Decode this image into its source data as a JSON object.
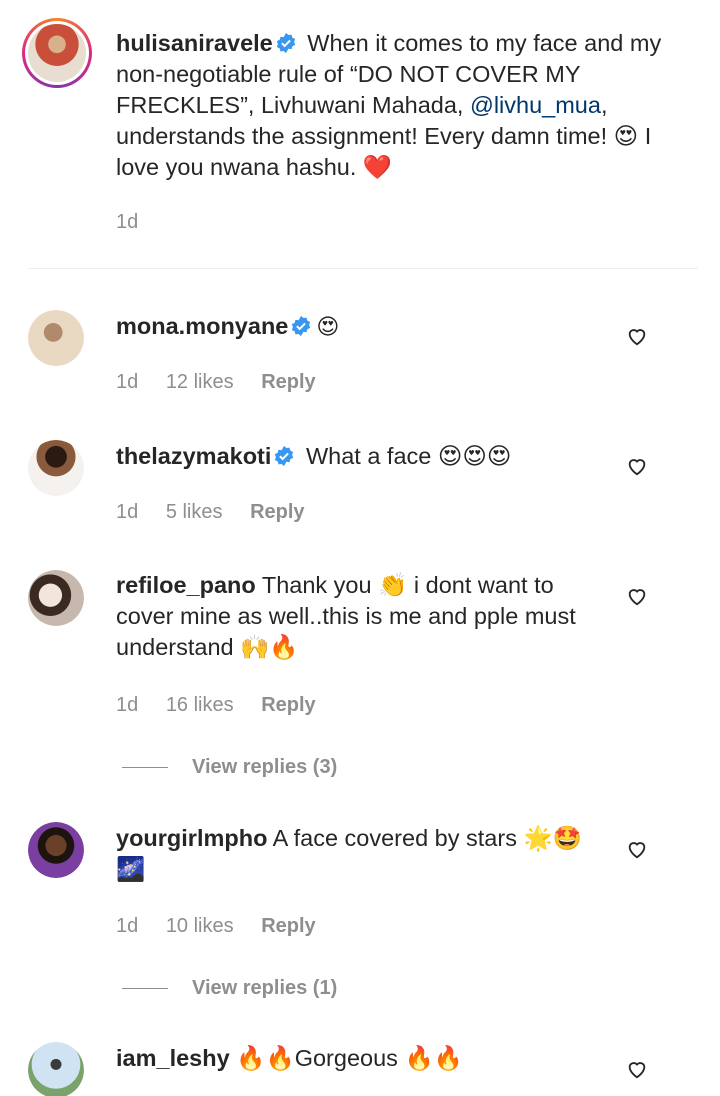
{
  "caption": {
    "username": "hulisaniravele",
    "text_before": " When it comes to my face and my non-negotiable rule of “DO NOT COVER MY FRECKLES”, Livhuwani Mahada, ",
    "mention": "@livhu_mua",
    "text_after": ", understands the assignment! Every damn time! 😍 I love you nwana hashu. ❤️",
    "time": "1d"
  },
  "comments": [
    {
      "username": "mona.monyane",
      "verified": true,
      "text": "😍",
      "time": "1d",
      "likes": "12 likes",
      "reply": "Reply"
    },
    {
      "username": "thelazymakoti",
      "verified": true,
      "text": " What a face 😍😍😍",
      "time": "1d",
      "likes": "5 likes",
      "reply": "Reply"
    },
    {
      "username": "refiloe_pano",
      "verified": false,
      "text": " Thank you 👏 i dont want to cover mine as well..this is me and pple must understand 🙌🔥",
      "time": "1d",
      "likes": "16 likes",
      "reply": "Reply",
      "view_replies": "View replies (3)"
    },
    {
      "username": "yourgirlmpho",
      "verified": false,
      "text": " A face covered by stars 🌟🤩 🌌",
      "time": "1d",
      "likes": "10 likes",
      "reply": "Reply",
      "view_replies": "View replies (1)"
    },
    {
      "username": "iam_leshy",
      "verified": false,
      "text": " 🔥🔥Gorgeous 🔥🔥"
    }
  ],
  "colors": {
    "verified": "#3897f0",
    "username": "#262626",
    "secondary": "#8e8e8e",
    "mention": "#00376b",
    "story_ring": "#dd2a7b"
  }
}
